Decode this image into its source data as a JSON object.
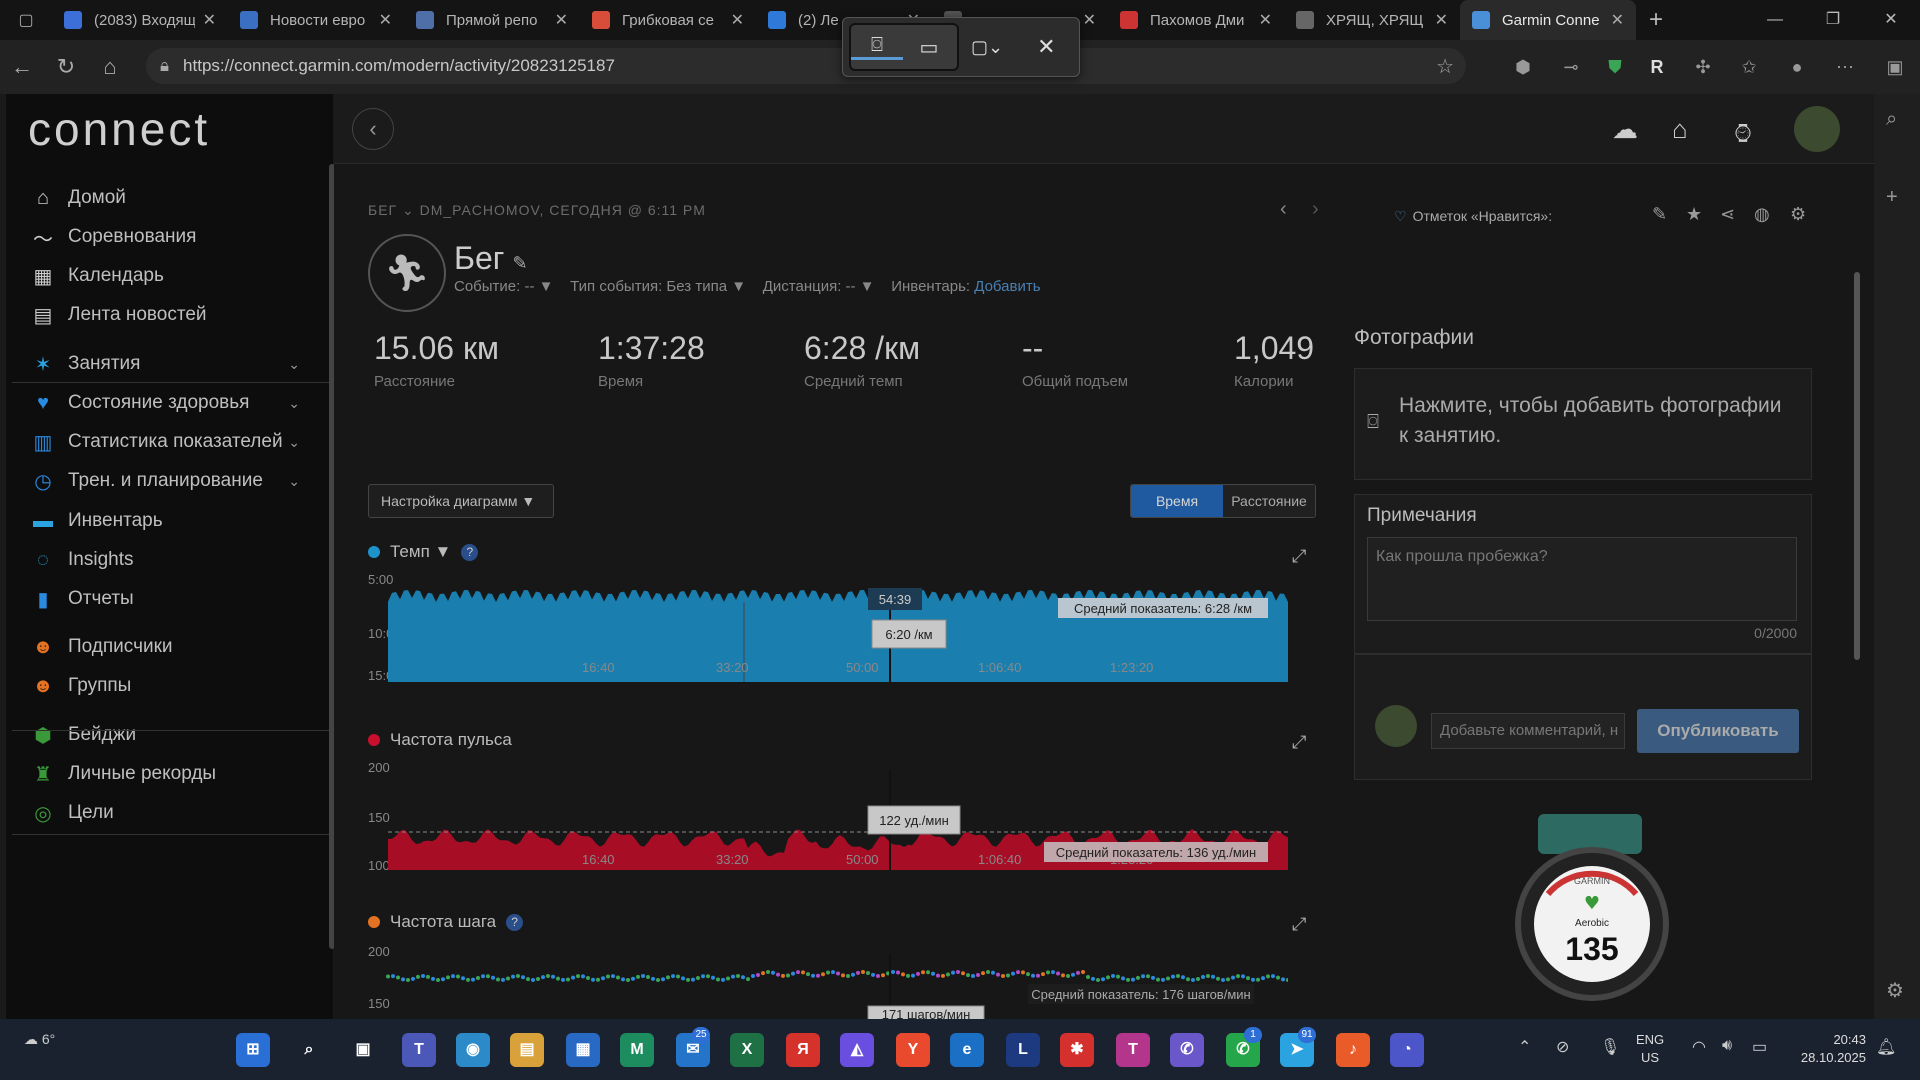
{
  "browser": {
    "tabs": [
      {
        "title": "(2083) Входящ",
        "color": "#3d6fd9"
      },
      {
        "title": "Новости евро",
        "color": "#3b6fc1"
      },
      {
        "title": "Прямой репо",
        "color": "#4e6fa8"
      },
      {
        "title": "Грибковая се",
        "color": "#d84d3a"
      },
      {
        "title": "(2) Ле",
        "color": "#2f7ad8"
      },
      {
        "title": "",
        "color": "#555555"
      },
      {
        "title": "Пахомов Дми",
        "color": "#c33"
      },
      {
        "title": "ХРЯЩ, ХРЯЩ",
        "color": "#666666"
      },
      {
        "title": "Garmin Conne",
        "color": "#4a90d9",
        "active": true
      }
    ],
    "url": "https://connect.garmin.com/modern/activity/20823125187"
  },
  "sidebar": {
    "logo": "connect",
    "items": [
      {
        "label": "Домой",
        "icon": "⌂"
      },
      {
        "label": "Соревнования",
        "icon": "〜"
      },
      {
        "label": "Календарь",
        "icon": "▦"
      },
      {
        "label": "Лента новостей",
        "icon": "▤"
      },
      {
        "label": "Занятия",
        "icon": "✶",
        "chev": true
      },
      {
        "label": "Состояние здоровья",
        "icon": "♥",
        "chev": true
      },
      {
        "label": "Статистика показателей",
        "icon": "▥",
        "chev": true
      },
      {
        "label": "Трен. и планирование",
        "icon": "◷",
        "chev": true
      },
      {
        "label": "Инвентарь",
        "icon": "▬"
      },
      {
        "label": "Insights",
        "icon": "◌"
      },
      {
        "label": "Отчеты",
        "icon": "▮"
      },
      {
        "label": "Подписчики",
        "icon": "☻"
      },
      {
        "label": "Группы",
        "icon": "☻"
      },
      {
        "label": "Бейджи",
        "icon": "⬢"
      },
      {
        "label": "Личные рекорды",
        "icon": "♜"
      },
      {
        "label": "Цели",
        "icon": "◎"
      }
    ]
  },
  "activity": {
    "breadcrumb": "БЕГ ⌄ DM_PACHOMOV, СЕГОДНЯ @ 6:11 PM",
    "title": "Бег",
    "meta": {
      "event": "Событие: -- ▼",
      "event_type": "Тип события: Без типа ▼",
      "distance": "Дистанция: -- ▼",
      "gear": "Инвентарь:",
      "gear_add": "Добавить"
    },
    "stats": [
      {
        "value": "15.06 км",
        "label": "Расстояние"
      },
      {
        "value": "1:37:28",
        "label": "Время"
      },
      {
        "value": "6:28 /км",
        "label": "Средний темп"
      },
      {
        "value": "--",
        "label": "Общий подъем"
      },
      {
        "value": "1,049",
        "label": "Калории"
      }
    ],
    "likes": "Отметок «Нравится»:"
  },
  "charts": {
    "settings_button": "Настройка диаграмм ▼",
    "toggle_time": "Время",
    "toggle_distance": "Расстояние",
    "x_ticks": [
      "16:40",
      "33:20",
      "50:00",
      "1:06:40",
      "1:23:20"
    ],
    "pace": {
      "title": "Темп",
      "y_ticks": [
        "5:00",
        "10:00",
        "15:00"
      ],
      "avg": "Средний показатель: 6:28 /км",
      "cursor_time": "54:39",
      "cursor_value": "6:20 /км",
      "color": "#1e93c9"
    },
    "hr": {
      "title": "Частота пульса",
      "y_ticks": [
        "200",
        "150",
        "100"
      ],
      "avg": "Средний показатель: 136 уд./мин",
      "cursor_value": "122 уд./мин",
      "color": "#c8102e"
    },
    "cadence": {
      "title": "Частота шага",
      "y_ticks": [
        "200",
        "150"
      ],
      "avg": "Средний показатель: 176 шагов/мин",
      "cursor_value": "171 шагов/мин",
      "color": "#e37222"
    }
  },
  "right": {
    "photos_title": "Фотографии",
    "photos_prompt": "Нажмите, чтобы добавить фотографии к занятию.",
    "notes_title": "Примечания",
    "notes_placeholder": "Как прошла пробежка?",
    "notes_counter": "0/2000",
    "comment_placeholder": "Добавьте комментарий, н",
    "publish": "Опубликовать",
    "watch_brand": "GARMIN",
    "watch_label": "Aerobic",
    "watch_value": "135"
  },
  "taskbar": {
    "weather": "6°",
    "lang_1": "ENG",
    "lang_2": "US",
    "time": "20:43",
    "date": "28.10.2025",
    "badge_1": "25",
    "badge_2": "1",
    "badge_3": "91"
  }
}
